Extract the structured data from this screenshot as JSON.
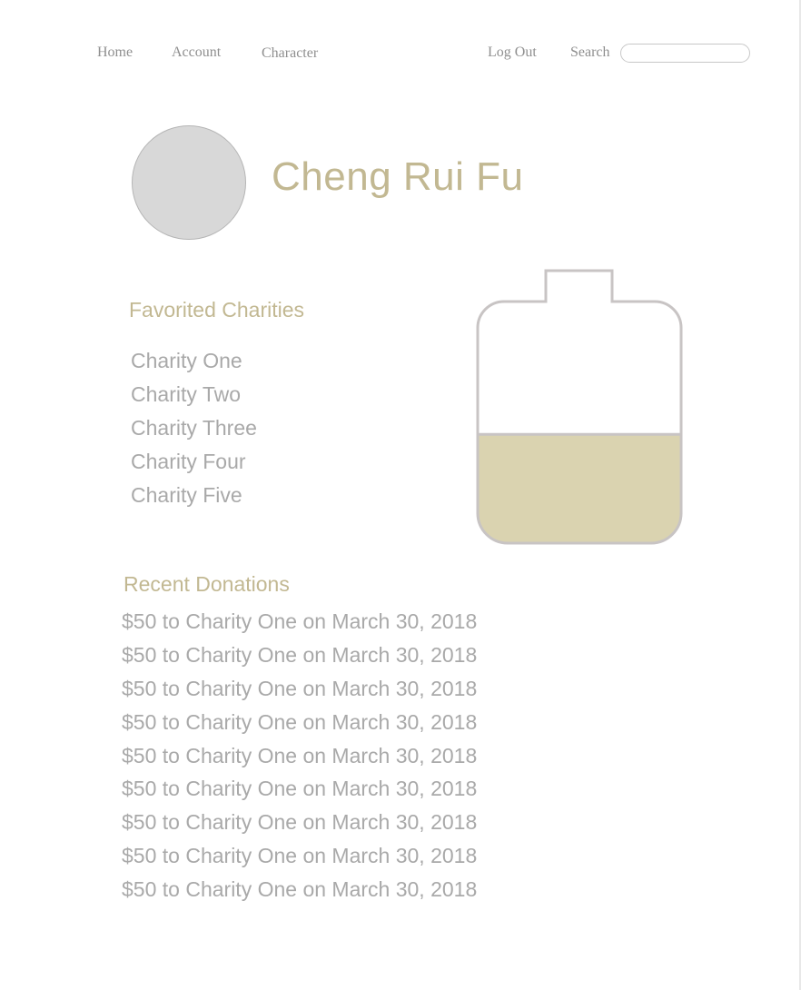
{
  "nav": {
    "home": "Home",
    "account": "Account",
    "character": "Character",
    "logout": "Log Out",
    "search_label": "Search",
    "search_value": ""
  },
  "profile": {
    "name": "Cheng Rui Fu"
  },
  "favorites": {
    "title": "Favorited Charities",
    "items": [
      "Charity One",
      "Charity Two",
      "Charity Three",
      "Charity Four",
      "Charity Five"
    ]
  },
  "jar": {
    "fill_fraction": 0.45,
    "fill_color": "#dad3b0",
    "outline_color": "#c8c4c4"
  },
  "donations": {
    "title": "Recent Donations",
    "items": [
      "$50 to Charity One on March 30, 2018",
      "$50 to Charity One on March 30, 2018",
      "$50 to Charity One on March 30, 2018",
      "$50 to Charity One on March 30, 2018",
      "$50 to Charity One on March 30, 2018",
      "$50 to Charity One on March 30, 2018",
      "$50 to Charity One on March 30, 2018",
      "$50 to Charity One on March 30, 2018",
      "$50 to Charity One on March 30, 2018"
    ]
  },
  "colors": {
    "accent": "#c2b892",
    "text_muted": "#a9a9a9",
    "nav_text": "#8f8f8f",
    "avatar_fill": "#d8d8d8"
  }
}
